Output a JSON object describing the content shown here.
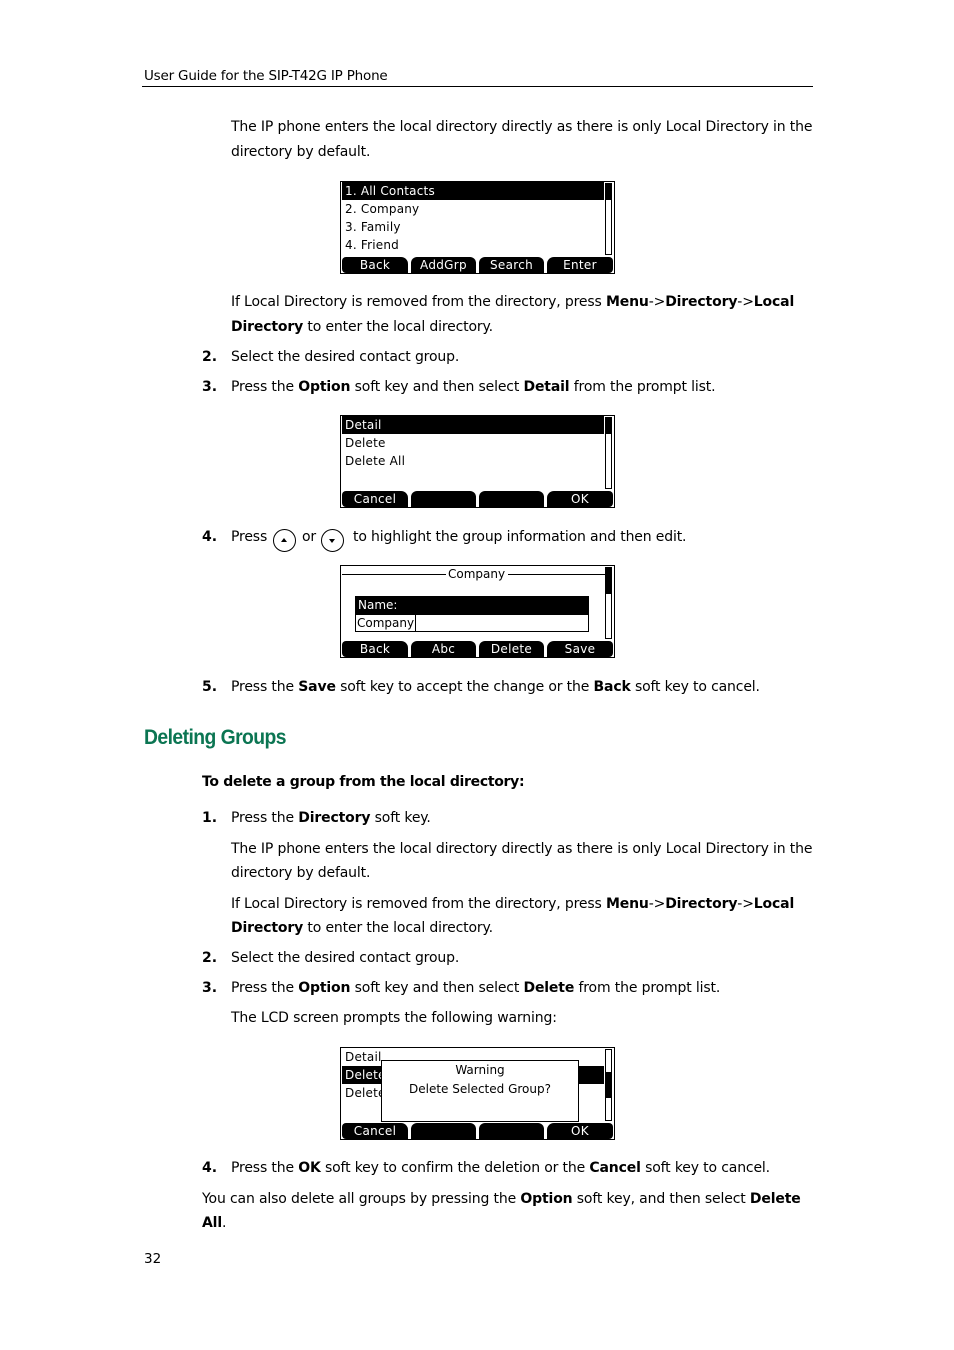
{
  "header": {
    "title": "User Guide for the SIP-T42G IP Phone"
  },
  "page_number": "32",
  "section1": {
    "intro_p1_line1": "The IP phone enters the local directory directly as there is only Local Directory in the",
    "intro_p1_line2": "directory by default.",
    "lcd_directory": {
      "items": [
        "1.  All Contacts",
        "2.  Company",
        "3.  Family",
        "4.  Friend"
      ],
      "selected_index": 0,
      "softkeys": [
        "Back",
        "AddGrp",
        "Search",
        "Enter"
      ]
    },
    "intro_p2": {
      "pre": "If Local Directory is removed from the directory, press ",
      "path1": "Menu",
      "sep1": "->",
      "path2": "Directory",
      "sep2": "->",
      "path3": "Local",
      "path4": "Directory",
      "post": " to enter the local directory."
    },
    "step2": {
      "num": "2.",
      "text": "Select the desired contact group."
    },
    "step3": {
      "num": "3.",
      "pre": "Press the ",
      "key": "Option",
      "mid": " soft key and then select ",
      "item": "Detail",
      "post": " from the prompt list."
    },
    "lcd_options": {
      "items": [
        "Detail",
        "Delete",
        "Delete All"
      ],
      "selected_index": 0,
      "softkeys": [
        "Cancel",
        "",
        "",
        "OK"
      ]
    },
    "step4": {
      "num": "4.",
      "pre": "Press",
      "or": "or",
      "post": "to highlight the group information and then edit.",
      "up_icon": "up-arrow",
      "down_icon": "down-arrow"
    },
    "lcd_edit": {
      "title": "Company",
      "field_label": "Name:",
      "field_value": "Company",
      "softkeys": [
        "Back",
        "Abc",
        "Delete",
        "Save"
      ]
    },
    "step5": {
      "num": "5.",
      "pre": "Press the ",
      "key1": "Save",
      "mid": " soft key to accept the change or the ",
      "key2": "Back",
      "post": " soft key to cancel."
    }
  },
  "section2": {
    "heading": "Deleting Groups",
    "subheading": "To delete a group from the local directory:",
    "step1": {
      "num": "1.",
      "pre": "Press the ",
      "key": "Directory",
      "post": " soft key."
    },
    "p1_line1": "The IP phone enters the local directory directly as there is only Local Directory in the",
    "p1_line2": "directory by default.",
    "p2": {
      "pre": "If Local Directory is removed from the directory, press ",
      "path1": "Menu",
      "sep1": "->",
      "path2": "Directory",
      "sep2": "->",
      "path3": "Local",
      "path4": "Directory",
      "post": " to enter the local directory."
    },
    "step2": {
      "num": "2.",
      "text": "Select the desired contact group."
    },
    "step3": {
      "num": "3.",
      "pre": "Press the ",
      "key": "Option",
      "mid": " soft key and then select ",
      "item": "Delete",
      "post": " from the prompt list."
    },
    "step3_note": "The LCD screen prompts the following warning:",
    "lcd_warning": {
      "items": [
        "Detail",
        "Delete",
        "Delete"
      ],
      "selected_index": 1,
      "dialog_title": "Warning",
      "dialog_message": "Delete Selected Group?",
      "softkeys": [
        "Cancel",
        "",
        "",
        "OK"
      ]
    },
    "step4": {
      "num": "4.",
      "pre": "Press the ",
      "key1": "OK",
      "mid": " soft key to confirm the deletion or the ",
      "key2": "Cancel",
      "post": " soft key to cancel."
    },
    "note": {
      "pre": "You can also delete all groups by pressing the ",
      "key": "Option",
      "mid": " soft key, and then select ",
      "item1": "Delete",
      "item2": "All",
      "post": "."
    }
  },
  "colors": {
    "heading_green": "#0b7552",
    "lcd_fg": "#000000",
    "lcd_bg": "#ffffff"
  }
}
